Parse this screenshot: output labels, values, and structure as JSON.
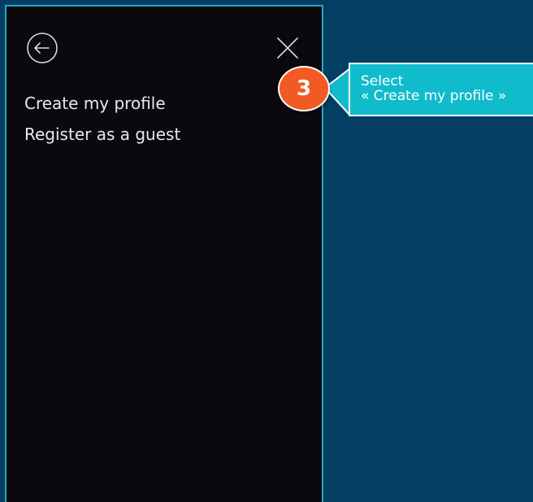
{
  "menu": {
    "back_icon": "back-arrow-circle-icon",
    "close_icon": "close-icon",
    "items": [
      {
        "label": "Create my profile"
      },
      {
        "label": "Register as a guest"
      }
    ]
  },
  "annotation": {
    "step_number": "3",
    "line1": "Select",
    "line2": "« Create my profile »",
    "badge_color": "#f15a24",
    "callout_color": "#10bccb"
  },
  "colors": {
    "background": "#043f63",
    "panel": "#0b090e",
    "panel_border": "#2aa7c9"
  }
}
